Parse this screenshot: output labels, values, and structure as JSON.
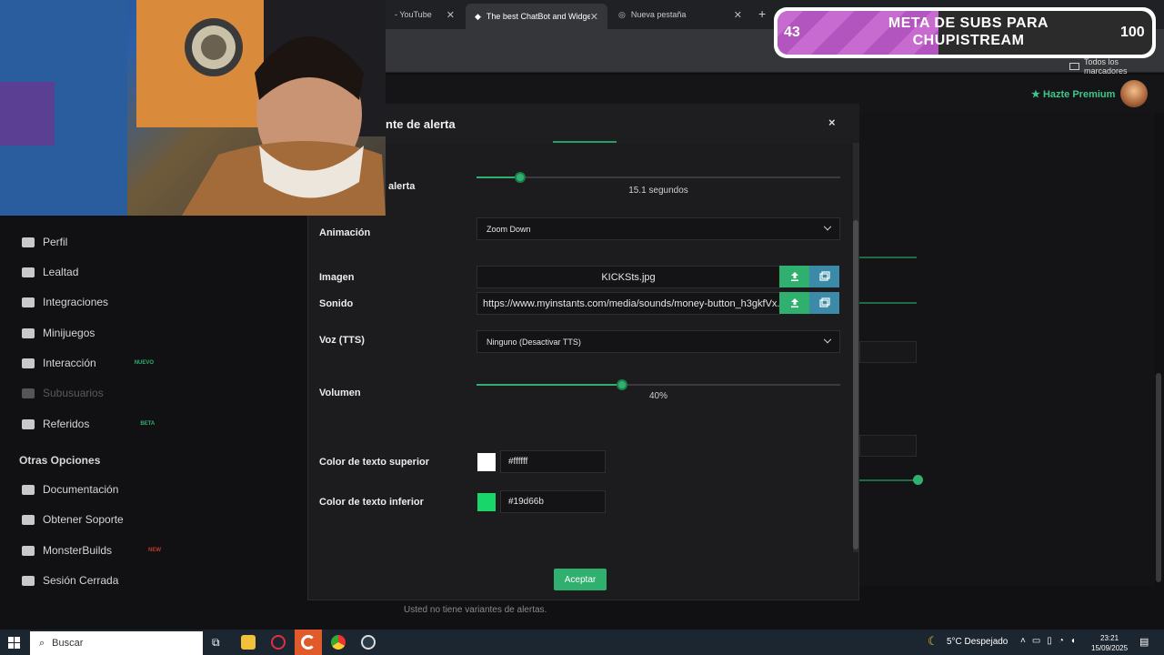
{
  "browser": {
    "tabs": [
      {
        "label": "- YouTube",
        "active": false
      },
      {
        "label": "The best ChatBot and Widgets",
        "active": true
      },
      {
        "label": "Nueva pestaña",
        "active": false
      }
    ],
    "bookmarks_label": "Todos los marcadores"
  },
  "topnav": {
    "premium_label": "Hazte Premium"
  },
  "sidebar": {
    "items": [
      {
        "label": "Perfil"
      },
      {
        "label": "Lealtad"
      },
      {
        "label": "Integraciones"
      },
      {
        "label": "Minijuegos"
      },
      {
        "label": "Interacción",
        "badge": "NUEVO"
      },
      {
        "label": "Subusuarios"
      },
      {
        "label": "Referidos",
        "badge": "BETA"
      }
    ],
    "other_heading": "Otras Opciones",
    "other_items": [
      {
        "label": "Documentación"
      },
      {
        "label": "Obtener Soporte"
      },
      {
        "label": "MonsterBuilds",
        "badge": "NEW"
      },
      {
        "label": "Sesión Cerrada"
      }
    ]
  },
  "modal": {
    "title": "nte de alerta",
    "close_symbol": "×",
    "duration": {
      "label": "alerta",
      "value_text": "15.1 segundos",
      "fraction": 0.12
    },
    "animation": {
      "label": "Animación",
      "selected": "Zoom Down"
    },
    "image": {
      "label": "Imagen",
      "value": "KICKSts.jpg"
    },
    "sound": {
      "label": "Sonido",
      "value": "https://www.myinstants.com/media/sounds/money-button_h3gkfVx."
    },
    "tts": {
      "label": "Voz (TTS)",
      "selected": "Ninguno (Desactivar TTS)"
    },
    "volume": {
      "label": "Volumen",
      "value_text": "40%",
      "fraction": 0.4
    },
    "top_color": {
      "label": "Color de texto superior",
      "value": "#ffffff",
      "swatch": "#ffffff"
    },
    "bottom_color": {
      "label": "Color de texto inferior",
      "value": "#19d66b",
      "swatch": "#19d66b"
    },
    "accept_label": "Aceptar"
  },
  "background": {
    "no_variants_text": "Usted no tiene variantes de alertas."
  },
  "overlay": {
    "sub_goal_title": "META DE SUBS PARA CHUPISTREAM",
    "sub_current": "43",
    "sub_target": "100",
    "progress_fraction": 0.43
  },
  "taskbar": {
    "search_placeholder": "Buscar",
    "weather": "5°C  Despejado",
    "time": "23:21",
    "date": "15/09/2025"
  },
  "colors": {
    "accent": "#2fb06e",
    "library": "#3a8aa8"
  }
}
